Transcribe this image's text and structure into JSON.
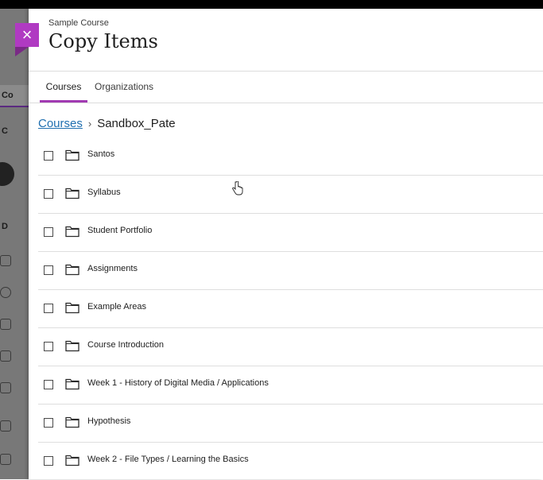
{
  "panel": {
    "subtitle": "Sample Course",
    "title": "Copy Items",
    "close_icon": "close-icon"
  },
  "tabs": [
    {
      "label": "Courses",
      "active": true
    },
    {
      "label": "Organizations",
      "active": false
    }
  ],
  "breadcrumb": {
    "root": "Courses",
    "separator": "›",
    "current": "Sandbox_Pate"
  },
  "items": [
    {
      "label": "Santos"
    },
    {
      "label": "Syllabus"
    },
    {
      "label": "Student Portfolio"
    },
    {
      "label": "Assignments"
    },
    {
      "label": "Example Areas"
    },
    {
      "label": "Course Introduction"
    },
    {
      "label": "Week 1 - History of Digital Media / Applications"
    },
    {
      "label": "Hypothesis"
    },
    {
      "label": "Week 2 - File Types / Learning the Basics"
    }
  ],
  "background_page": {
    "tab_fragment": "Co",
    "letters": [
      "C",
      "D"
    ]
  },
  "colors": {
    "accent": "#a13ab2",
    "link": "#1f6fb0",
    "overlay": "#787878"
  }
}
